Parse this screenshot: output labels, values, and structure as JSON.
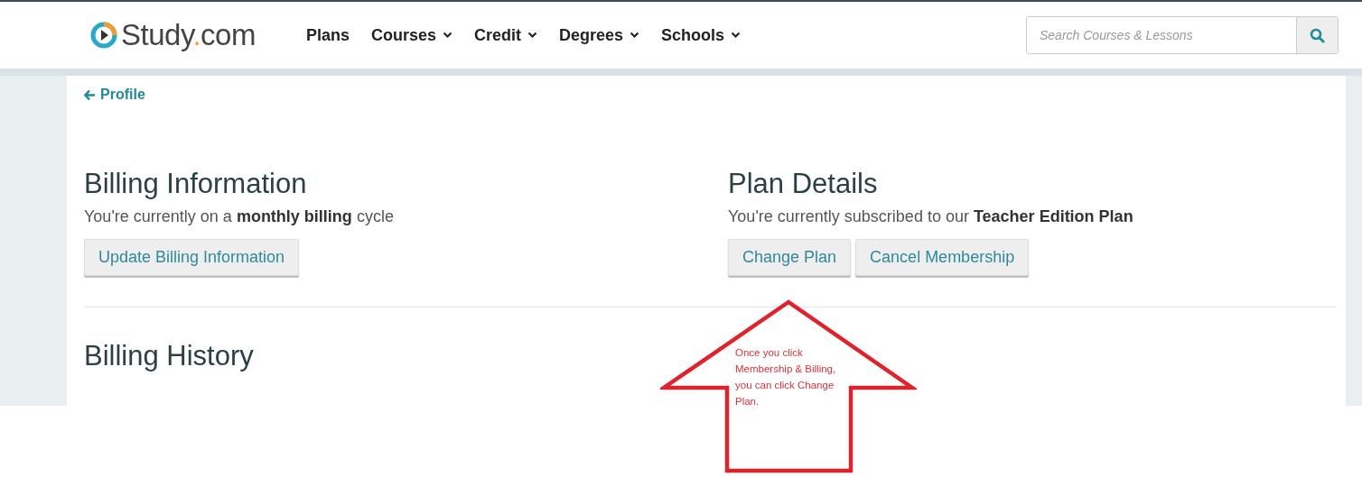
{
  "header": {
    "logo": {
      "before": "Study",
      "dot": ".",
      "after": "com"
    },
    "nav": [
      {
        "label": "Plans",
        "dropdown": false
      },
      {
        "label": "Courses",
        "dropdown": true
      },
      {
        "label": "Credit",
        "dropdown": true
      },
      {
        "label": "Degrees",
        "dropdown": true
      },
      {
        "label": "Schools",
        "dropdown": true
      }
    ],
    "search": {
      "placeholder": "Search Courses & Lessons"
    }
  },
  "back_link": "Profile",
  "sections": [
    {
      "title": "Billing Information",
      "text": "You're currently on a **monthly billing** cycle",
      "buttons": [
        "Update Billing Information"
      ]
    },
    {
      "title": "Plan Details",
      "text": "You're currently subscribed to our **Teacher Edition Plan**",
      "buttons": [
        "Change Plan",
        "Cancel Membership"
      ]
    }
  ],
  "history": {
    "title": "Billing History"
  },
  "annotation": {
    "text": "Once you click Membership & Billing, you can click Change Plan."
  }
}
